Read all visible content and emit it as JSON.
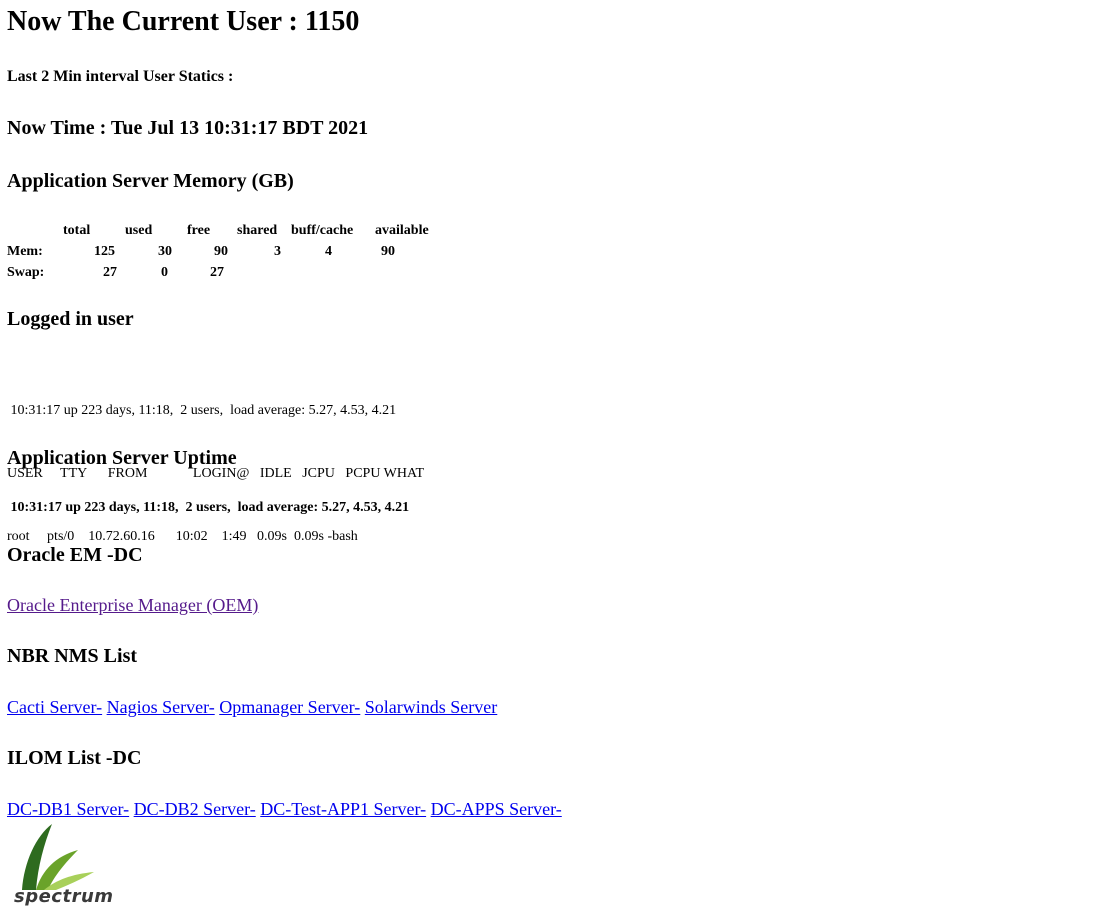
{
  "header": {
    "current_user": "Now The Current User : 1150",
    "interval_stats": "Last 2 Min interval User Statics :",
    "now_time": "Now Time : Tue Jul 13 10:31:17 BDT 2021"
  },
  "memory": {
    "title": "Application Server Memory (GB)",
    "columns": [
      "",
      "total",
      "used",
      "free",
      "shared",
      "buff/cache",
      "available"
    ],
    "rows": [
      [
        "Mem:",
        "125",
        "30",
        "90",
        "3",
        "4",
        "90"
      ],
      [
        "Swap:",
        "27",
        "0",
        "27",
        "",
        "",
        ""
      ]
    ]
  },
  "logged_in": {
    "title": "Logged in user",
    "line1": " 10:31:17 up 223 days, 11:18,  2 users,  load average: 5.27, 4.53, 4.21",
    "line2": "USER     TTY      FROM             LOGIN@   IDLE   JCPU   PCPU WHAT",
    "line3": "root     pts/0    10.72.60.16      10:02    1:49   0.09s  0.09s -bash"
  },
  "uptime": {
    "title": "Application Server Uptime",
    "line": " 10:31:17 up 223 days, 11:18,  2 users,  load average: 5.27, 4.53, 4.21"
  },
  "oracle": {
    "title": "Oracle EM -DC",
    "link": "Oracle Enterprise Manager (OEM)"
  },
  "nms": {
    "title": "NBR NMS List",
    "links": [
      "Cacti Server-",
      "Nagios Server-",
      "Opmanager Server-",
      "Solarwinds Server"
    ]
  },
  "ilom": {
    "title": "ILOM List -DC",
    "links": [
      "DC-DB1 Server-",
      "DC-DB2 Server-",
      "DC-Test-APP1 Server-",
      "DC-APPS Server-"
    ]
  },
  "logo": {
    "text": "spectrum",
    "colors": {
      "dark_green": "#2e6b1f",
      "mid_green": "#6aa32a",
      "light_green": "#a8d05a"
    }
  },
  "colors": {
    "link": "#0000ee",
    "visited_link": "#551a8b",
    "text": "#000000",
    "background": "#ffffff"
  }
}
